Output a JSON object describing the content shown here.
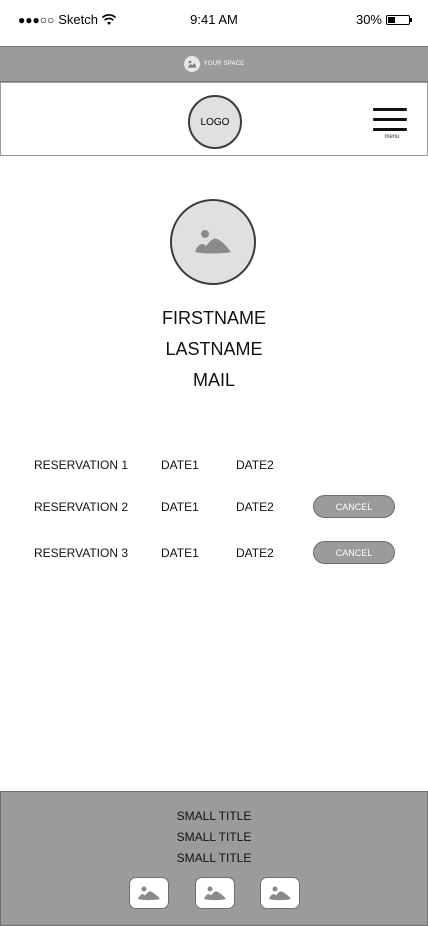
{
  "status_bar": {
    "signal": "●●●○○",
    "carrier": "Sketch",
    "time": "9:41 AM",
    "battery": "30%"
  },
  "banner": {
    "text": "YOUR SPACE"
  },
  "header": {
    "logo": "LOGO",
    "menu_label": "menu"
  },
  "profile": {
    "firstname": "FIRSTNAME",
    "lastname": "LASTNAME",
    "mail": "MAIL"
  },
  "reservations": [
    {
      "name": "RESERVATION 1",
      "date1": "DATE1",
      "date2": "DATE2"
    },
    {
      "name": "RESERVATION 2",
      "date1": "DATE1",
      "date2": "DATE2",
      "cancel_label": "CANCEL"
    },
    {
      "name": "RESERVATION 3",
      "date1": "DATE1",
      "date2": "DATE2",
      "cancel_label": "CANCEL"
    }
  ],
  "footer": {
    "titles": [
      "SMALL TITLE",
      "SMALL TITLE",
      "SMALL TITLE"
    ],
    "icons": [
      "image-icon",
      "image-icon",
      "image-icon"
    ]
  }
}
